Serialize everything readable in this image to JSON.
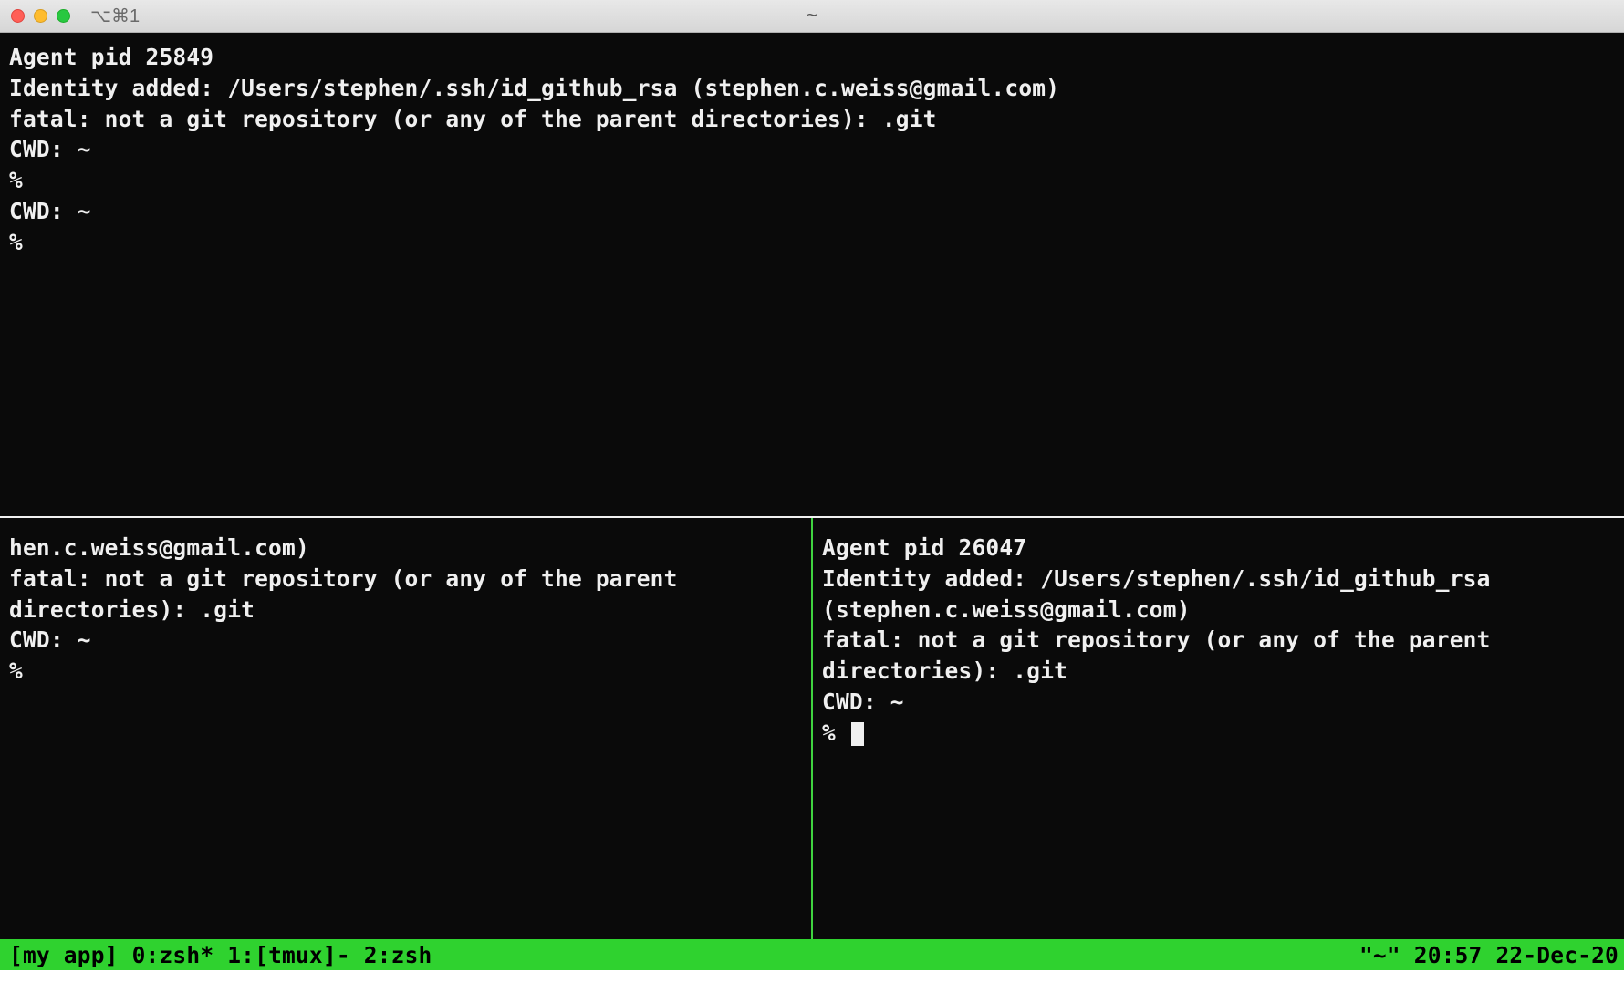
{
  "titlebar": {
    "shortcut_label": "⌥⌘1",
    "title": "~"
  },
  "panes": {
    "top": {
      "lines": [
        "Agent pid 25849",
        "Identity added: /Users/stephen/.ssh/id_github_rsa (stephen.c.weiss@gmail.com)",
        "fatal: not a git repository (or any of the parent directories): .git",
        "CWD: ~",
        "%",
        "CWD: ~",
        "%"
      ]
    },
    "bottom_left": {
      "lines": [
        "hen.c.weiss@gmail.com)",
        "fatal: not a git repository (or any of the parent directories): .git",
        "CWD: ~",
        "%"
      ]
    },
    "bottom_right": {
      "lines": [
        "Agent pid 26047",
        "Identity added: /Users/stephen/.ssh/id_github_rsa (stephen.c.weiss@gmail.com)",
        "fatal: not a git repository (or any of the parent directories): .git",
        "CWD: ~"
      ],
      "prompt": "% "
    }
  },
  "statusbar": {
    "session": "[my app]",
    "windows": "0:zsh* 1:[tmux]- 2:zsh",
    "right": "\"~\" 20:57 22-Dec-20"
  }
}
